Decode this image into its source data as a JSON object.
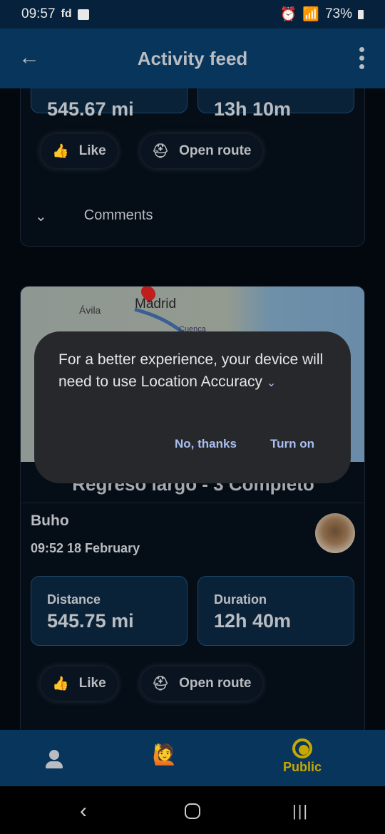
{
  "status_bar": {
    "time": "09:57",
    "carrier": "fd",
    "battery": "73%"
  },
  "app_bar": {
    "title": "Activity feed",
    "back_icon": "arrow-left-icon",
    "menu_icon": "more-vert-icon"
  },
  "feed": {
    "card1": {
      "distance_value": "545.67 mi",
      "duration_value": "13h 10m",
      "like_label": "Like",
      "open_route_label": "Open route",
      "comments_label": "Comments"
    },
    "card2": {
      "map_labels": [
        "Madrid",
        "Ávila",
        "Cuenca"
      ],
      "title": "Regreso largo - 3 Completo",
      "user": "Buho",
      "datetime": "09:52 18 February",
      "distance_label": "Distance",
      "distance_value": "545.75 mi",
      "duration_label": "Duration",
      "duration_value": "12h 40m",
      "like_label": "Like",
      "open_route_label": "Open route"
    }
  },
  "dialog": {
    "message": "For a better experience, your device will need to use Location Accuracy",
    "no_label": "No, thanks",
    "yes_label": "Turn on"
  },
  "bottom_nav": {
    "items": [
      {
        "icon": "person-icon",
        "label": ""
      },
      {
        "icon": "walking-person-icon",
        "label": ""
      },
      {
        "icon": "globe-icon",
        "label": "Public",
        "active": true
      }
    ],
    "active_color": "#c8a800"
  }
}
